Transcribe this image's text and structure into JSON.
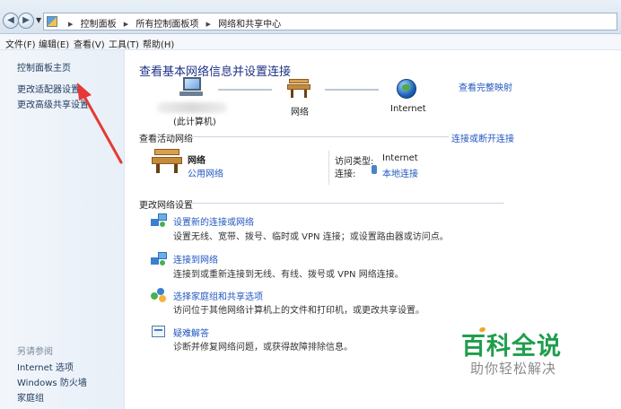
{
  "breadcrumb": {
    "items": [
      "控制面板",
      "所有控制面板项",
      "网络和共享中心"
    ]
  },
  "menu": {
    "items": [
      "文件(F)",
      "编辑(E)",
      "查看(V)",
      "工具(T)",
      "帮助(H)"
    ]
  },
  "sidebar": {
    "home": "控制面板主页",
    "adapter": "更改适配器设置",
    "advanced": "更改高级共享设置",
    "see_also_title": "另请参阅",
    "see_also": [
      "Internet 选项",
      "Windows 防火墙",
      "家庭组"
    ]
  },
  "main": {
    "title": "查看基本网络信息并设置连接",
    "full_map": "查看完整映射",
    "map": {
      "computer": "(此计算机)",
      "network": "网络",
      "internet": "Internet"
    },
    "active": {
      "heading": "查看活动网络",
      "connect_link": "连接或断开连接",
      "name": "网络",
      "type": "公用网络",
      "access_label": "访问类型:",
      "access_value": "Internet",
      "conn_label": "连接:",
      "conn_value": "本地连接"
    },
    "settings": {
      "heading": "更改网络设置",
      "tasks": [
        {
          "title": "设置新的连接或网络",
          "desc": "设置无线、宽带、拨号、临时或 VPN 连接；或设置路由器或访问点。"
        },
        {
          "title": "连接到网络",
          "desc": "连接到或重新连接到无线、有线、拨号或 VPN 网络连接。"
        },
        {
          "title": "选择家庭组和共享选项",
          "desc": "访问位于其他网络计算机上的文件和打印机，或更改共享设置。"
        },
        {
          "title": "疑难解答",
          "desc": "诊断并修复网络问题，或获得故障排除信息。"
        }
      ]
    }
  },
  "watermark": {
    "title": "百科全说",
    "subtitle": "助你轻松解决"
  },
  "colors": {
    "link": "#2156bf",
    "title": "#1e3287",
    "watermark": "#1f9e4c",
    "arrow": "#e53935"
  }
}
